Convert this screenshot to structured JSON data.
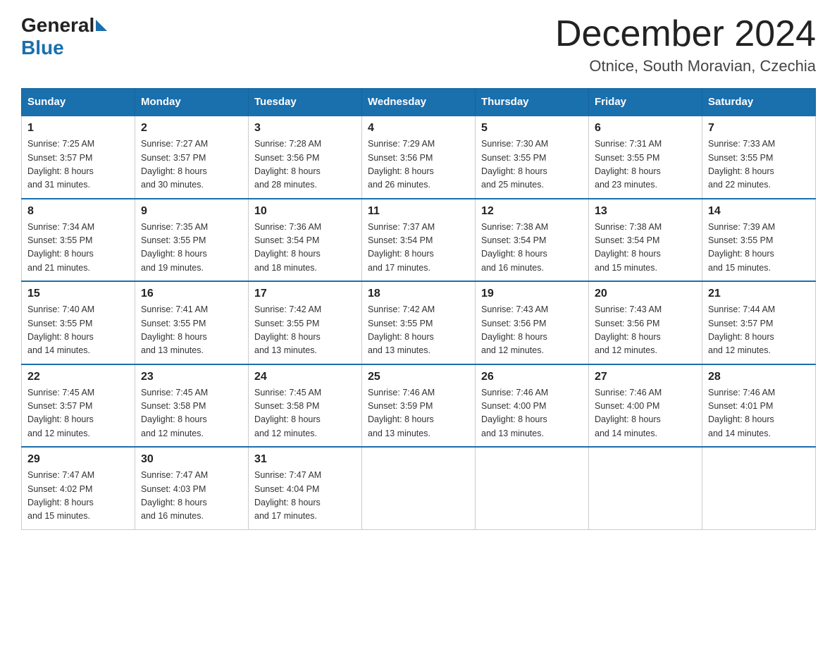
{
  "header": {
    "logo_general": "General",
    "logo_blue": "Blue",
    "month_title": "December 2024",
    "location": "Otnice, South Moravian, Czechia"
  },
  "days_of_week": [
    "Sunday",
    "Monday",
    "Tuesday",
    "Wednesday",
    "Thursday",
    "Friday",
    "Saturday"
  ],
  "weeks": [
    [
      {
        "day": "1",
        "sunrise": "7:25 AM",
        "sunset": "3:57 PM",
        "daylight": "8 hours and 31 minutes."
      },
      {
        "day": "2",
        "sunrise": "7:27 AM",
        "sunset": "3:57 PM",
        "daylight": "8 hours and 30 minutes."
      },
      {
        "day": "3",
        "sunrise": "7:28 AM",
        "sunset": "3:56 PM",
        "daylight": "8 hours and 28 minutes."
      },
      {
        "day": "4",
        "sunrise": "7:29 AM",
        "sunset": "3:56 PM",
        "daylight": "8 hours and 26 minutes."
      },
      {
        "day": "5",
        "sunrise": "7:30 AM",
        "sunset": "3:55 PM",
        "daylight": "8 hours and 25 minutes."
      },
      {
        "day": "6",
        "sunrise": "7:31 AM",
        "sunset": "3:55 PM",
        "daylight": "8 hours and 23 minutes."
      },
      {
        "day": "7",
        "sunrise": "7:33 AM",
        "sunset": "3:55 PM",
        "daylight": "8 hours and 22 minutes."
      }
    ],
    [
      {
        "day": "8",
        "sunrise": "7:34 AM",
        "sunset": "3:55 PM",
        "daylight": "8 hours and 21 minutes."
      },
      {
        "day": "9",
        "sunrise": "7:35 AM",
        "sunset": "3:55 PM",
        "daylight": "8 hours and 19 minutes."
      },
      {
        "day": "10",
        "sunrise": "7:36 AM",
        "sunset": "3:54 PM",
        "daylight": "8 hours and 18 minutes."
      },
      {
        "day": "11",
        "sunrise": "7:37 AM",
        "sunset": "3:54 PM",
        "daylight": "8 hours and 17 minutes."
      },
      {
        "day": "12",
        "sunrise": "7:38 AM",
        "sunset": "3:54 PM",
        "daylight": "8 hours and 16 minutes."
      },
      {
        "day": "13",
        "sunrise": "7:38 AM",
        "sunset": "3:54 PM",
        "daylight": "8 hours and 15 minutes."
      },
      {
        "day": "14",
        "sunrise": "7:39 AM",
        "sunset": "3:55 PM",
        "daylight": "8 hours and 15 minutes."
      }
    ],
    [
      {
        "day": "15",
        "sunrise": "7:40 AM",
        "sunset": "3:55 PM",
        "daylight": "8 hours and 14 minutes."
      },
      {
        "day": "16",
        "sunrise": "7:41 AM",
        "sunset": "3:55 PM",
        "daylight": "8 hours and 13 minutes."
      },
      {
        "day": "17",
        "sunrise": "7:42 AM",
        "sunset": "3:55 PM",
        "daylight": "8 hours and 13 minutes."
      },
      {
        "day": "18",
        "sunrise": "7:42 AM",
        "sunset": "3:55 PM",
        "daylight": "8 hours and 13 minutes."
      },
      {
        "day": "19",
        "sunrise": "7:43 AM",
        "sunset": "3:56 PM",
        "daylight": "8 hours and 12 minutes."
      },
      {
        "day": "20",
        "sunrise": "7:43 AM",
        "sunset": "3:56 PM",
        "daylight": "8 hours and 12 minutes."
      },
      {
        "day": "21",
        "sunrise": "7:44 AM",
        "sunset": "3:57 PM",
        "daylight": "8 hours and 12 minutes."
      }
    ],
    [
      {
        "day": "22",
        "sunrise": "7:45 AM",
        "sunset": "3:57 PM",
        "daylight": "8 hours and 12 minutes."
      },
      {
        "day": "23",
        "sunrise": "7:45 AM",
        "sunset": "3:58 PM",
        "daylight": "8 hours and 12 minutes."
      },
      {
        "day": "24",
        "sunrise": "7:45 AM",
        "sunset": "3:58 PM",
        "daylight": "8 hours and 12 minutes."
      },
      {
        "day": "25",
        "sunrise": "7:46 AM",
        "sunset": "3:59 PM",
        "daylight": "8 hours and 13 minutes."
      },
      {
        "day": "26",
        "sunrise": "7:46 AM",
        "sunset": "4:00 PM",
        "daylight": "8 hours and 13 minutes."
      },
      {
        "day": "27",
        "sunrise": "7:46 AM",
        "sunset": "4:00 PM",
        "daylight": "8 hours and 14 minutes."
      },
      {
        "day": "28",
        "sunrise": "7:46 AM",
        "sunset": "4:01 PM",
        "daylight": "8 hours and 14 minutes."
      }
    ],
    [
      {
        "day": "29",
        "sunrise": "7:47 AM",
        "sunset": "4:02 PM",
        "daylight": "8 hours and 15 minutes."
      },
      {
        "day": "30",
        "sunrise": "7:47 AM",
        "sunset": "4:03 PM",
        "daylight": "8 hours and 16 minutes."
      },
      {
        "day": "31",
        "sunrise": "7:47 AM",
        "sunset": "4:04 PM",
        "daylight": "8 hours and 17 minutes."
      },
      null,
      null,
      null,
      null
    ]
  ],
  "labels": {
    "sunrise": "Sunrise:",
    "sunset": "Sunset:",
    "daylight": "Daylight:"
  }
}
